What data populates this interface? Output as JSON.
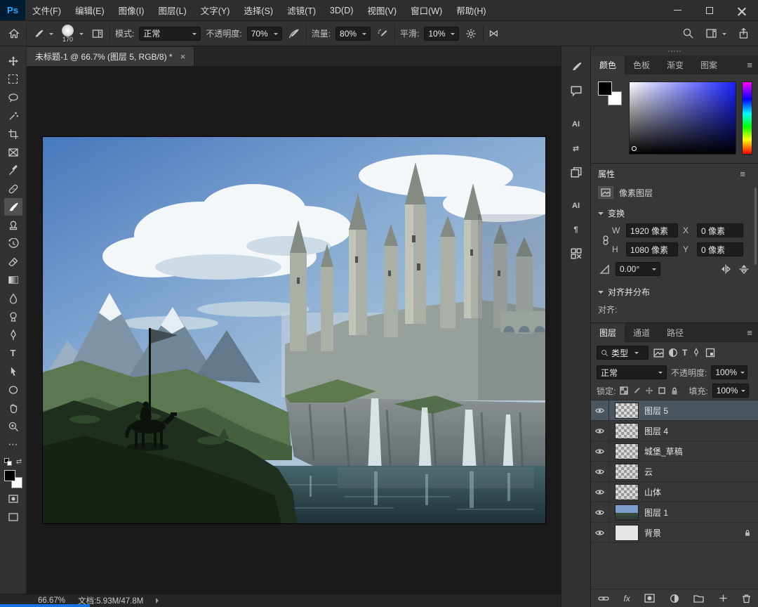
{
  "app": {
    "logo": "Ps"
  },
  "menu": {
    "items": [
      "文件(F)",
      "编辑(E)",
      "图像(I)",
      "图层(L)",
      "文字(Y)",
      "选择(S)",
      "滤镜(T)",
      "3D(D)",
      "视图(V)",
      "窗口(W)",
      "帮助(H)"
    ]
  },
  "options": {
    "brush_size": "170",
    "mode_label": "模式:",
    "mode_value": "正常",
    "opacity_label": "不透明度:",
    "opacity_value": "70%",
    "flow_label": "流量:",
    "flow_value": "80%",
    "smooth_label": "平滑:",
    "smooth_value": "10%"
  },
  "document_tab": {
    "title": "未标题-1 @ 66.7% (图层 5, RGB/8) *",
    "close_glyph": "×"
  },
  "icons": {
    "type_tool": "T",
    "ai": "AI",
    "paragraph": "¶",
    "ellipsis": "⋯",
    "symmetry": "⋈",
    "swap_arrows": "⇄",
    "menu": "≡",
    "fx": "fx"
  },
  "color_panel": {
    "tabs": [
      "颜色",
      "色板",
      "渐变",
      "图案"
    ]
  },
  "properties_panel": {
    "title": "属性",
    "layer_type": "像素图层",
    "transform_title": "变换",
    "w_label": "W",
    "w_value": "1920 像素",
    "x_label": "X",
    "x_value": "0 像素",
    "h_label": "H",
    "h_value": "1080 像素",
    "y_label": "Y",
    "y_value": "0 像素",
    "angle_value": "0.00°",
    "align_title": "对齐并分布",
    "align_label": "对齐:"
  },
  "layers_panel": {
    "tabs": [
      "图层",
      "通道",
      "路径"
    ],
    "filter_label": "类型",
    "blend_mode": "正常",
    "opacity_label": "不透明度:",
    "opacity_value": "100%",
    "lock_label": "锁定:",
    "fill_label": "填充:",
    "fill_value": "100%",
    "rows": [
      {
        "name": "图层 5"
      },
      {
        "name": "图层 4"
      },
      {
        "name": "城堡_草稿"
      },
      {
        "name": "云"
      },
      {
        "name": "山体"
      },
      {
        "name": "图层 1"
      },
      {
        "name": "背景"
      }
    ]
  },
  "status_bar": {
    "zoom": "66.67%",
    "doc_info": "文档:5.93M/47.8M"
  }
}
